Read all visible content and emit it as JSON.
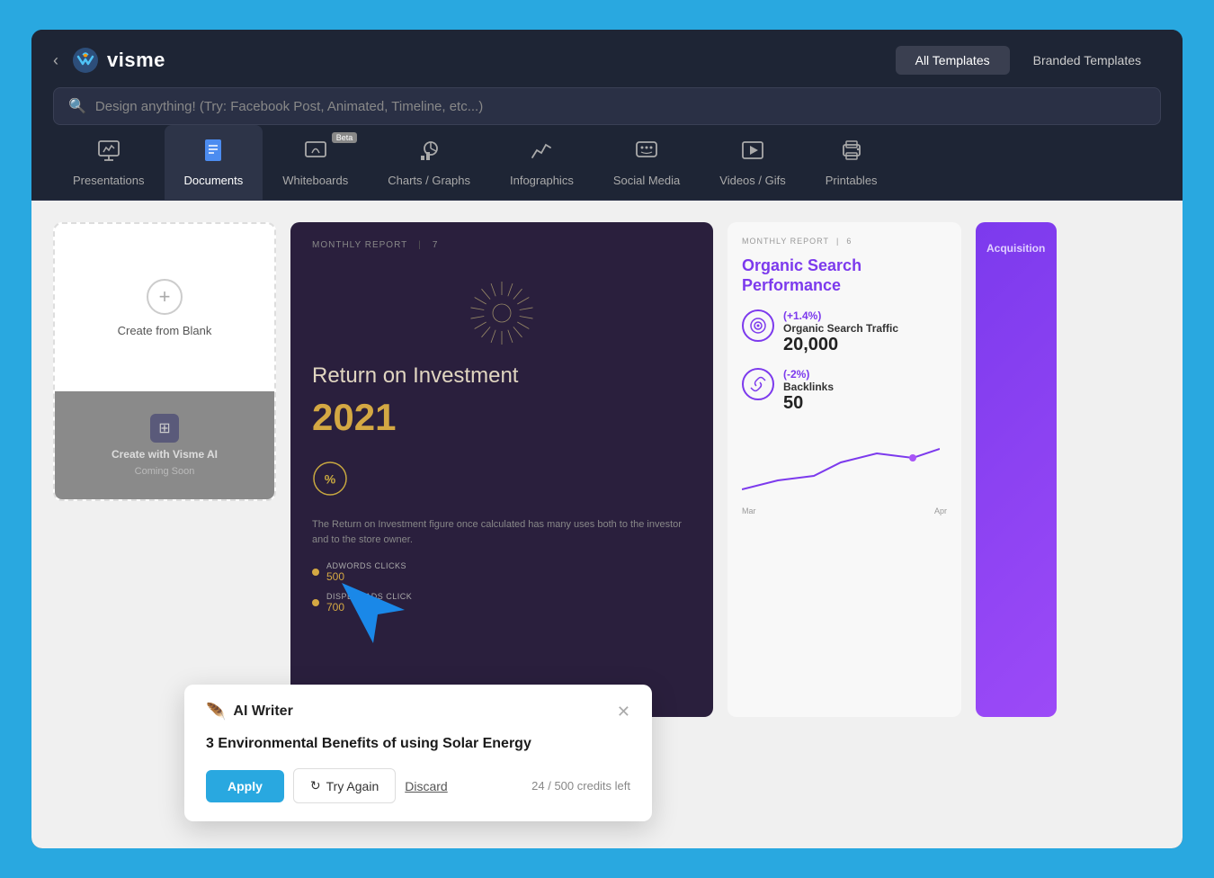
{
  "header": {
    "logo": "visme",
    "tabs": [
      {
        "label": "All Templates",
        "active": true
      },
      {
        "label": "Branded Templates",
        "active": false
      }
    ],
    "search_placeholder": "Design anything! (Try: Facebook Post, Animated, Timeline, etc...)"
  },
  "categories": [
    {
      "id": "presentations",
      "label": "Presentations",
      "icon": "📊",
      "active": false
    },
    {
      "id": "documents",
      "label": "Documents",
      "icon": "📄",
      "active": true
    },
    {
      "id": "whiteboards",
      "label": "Whiteboards",
      "icon": "✏️",
      "active": false,
      "beta": true
    },
    {
      "id": "charts",
      "label": "Charts / Graphs",
      "icon": "📈",
      "active": false
    },
    {
      "id": "infographics",
      "label": "Infographics",
      "icon": "📉",
      "active": false
    },
    {
      "id": "social-media",
      "label": "Social Media",
      "icon": "💬",
      "active": false
    },
    {
      "id": "videos",
      "label": "Videos / Gifs",
      "icon": "▶️",
      "active": false
    },
    {
      "id": "printables",
      "label": "Printables",
      "icon": "🖨️",
      "active": false
    }
  ],
  "create_blank": {
    "label": "Create from Blank",
    "ai_label": "Create with Visme AI",
    "coming_soon": "Coming Soon"
  },
  "template_dark": {
    "report_header": "MONTHLY REPORT",
    "report_number": "7",
    "roi_title": "Return on Investment",
    "roi_year": "2021",
    "description": "The Return on Investment figure once calculated has many uses both to the investor and to the store owner.",
    "metrics": [
      {
        "label": "ADWORDS CLICKS",
        "value": "500"
      },
      {
        "label": "DISPLAY ADS CLICK",
        "value": "700"
      }
    ]
  },
  "template_light": {
    "report_header": "MONTHLY REPORT",
    "report_number": "6",
    "organic_title": "Organic Search Performance",
    "acquisition_title": "Acquisition",
    "metrics": [
      {
        "change": "(+1.4%)",
        "name": "Organic Search Traffic",
        "value": "20,000"
      },
      {
        "change": "(-2%)",
        "name": "Backlinks",
        "value": "50"
      }
    ],
    "chart_labels": [
      "Mar",
      "Apr"
    ]
  },
  "ai_writer_popup": {
    "title": "AI Writer",
    "content": "3 Environmental Benefits of using Solar Energy",
    "buttons": {
      "apply": "Apply",
      "try_again": "Try Again",
      "discard": "Discard"
    },
    "credits": "24 / 500 credits left"
  }
}
